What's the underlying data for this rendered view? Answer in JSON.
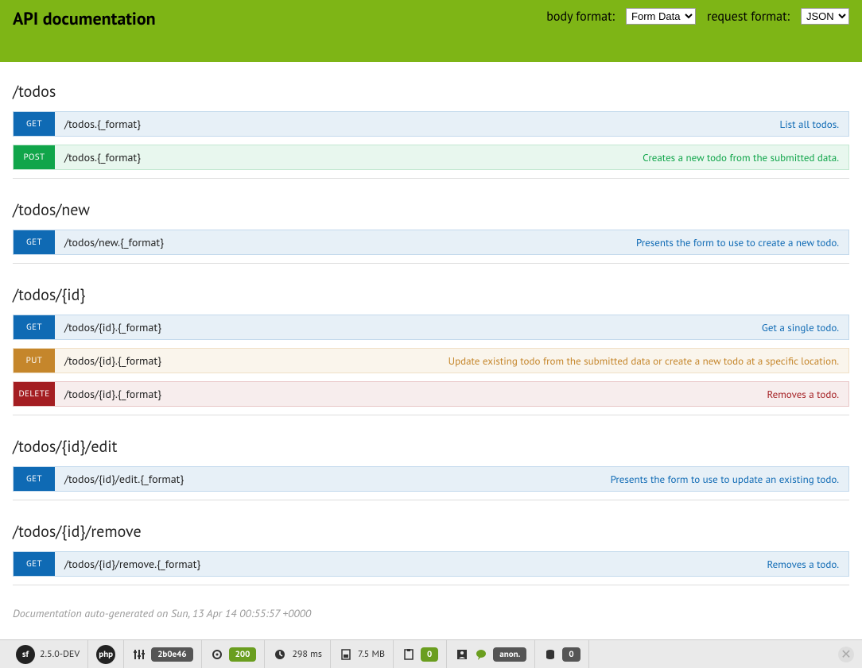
{
  "header": {
    "title": "API documentation",
    "body_format_label": "body format:",
    "body_format_value": "Form Data",
    "request_format_label": "request format:",
    "request_format_value": "JSON"
  },
  "sections": [
    {
      "title": "/todos",
      "endpoints": [
        {
          "method": "GET",
          "path": "/todos.{_format}",
          "desc": "List all todos."
        },
        {
          "method": "POST",
          "path": "/todos.{_format}",
          "desc": "Creates a new todo from the submitted data."
        }
      ]
    },
    {
      "title": "/todos/new",
      "endpoints": [
        {
          "method": "GET",
          "path": "/todos/new.{_format}",
          "desc": "Presents the form to use to create a new todo."
        }
      ]
    },
    {
      "title": "/todos/{id}",
      "endpoints": [
        {
          "method": "GET",
          "path": "/todos/{id}.{_format}",
          "desc": "Get a single todo."
        },
        {
          "method": "PUT",
          "path": "/todos/{id}.{_format}",
          "desc": "Update existing todo from the submitted data or create a new todo at a specific location."
        },
        {
          "method": "DELETE",
          "path": "/todos/{id}.{_format}",
          "desc": "Removes a todo."
        }
      ]
    },
    {
      "title": "/todos/{id}/edit",
      "endpoints": [
        {
          "method": "GET",
          "path": "/todos/{id}/edit.{_format}",
          "desc": "Presents the form to use to update an existing todo."
        }
      ]
    },
    {
      "title": "/todos/{id}/remove",
      "endpoints": [
        {
          "method": "GET",
          "path": "/todos/{id}/remove.{_format}",
          "desc": "Removes a todo."
        }
      ]
    }
  ],
  "footnote": "Documentation auto-generated on Sun, 13 Apr 14 00:55:57 +0000",
  "debug": {
    "version": "2.5.0-DEV",
    "php_label": "php",
    "token": "2b0e46",
    "status": "200",
    "time": "298 ms",
    "memory": "7.5 MB",
    "forms": "0",
    "user": "anon.",
    "db": "0"
  }
}
